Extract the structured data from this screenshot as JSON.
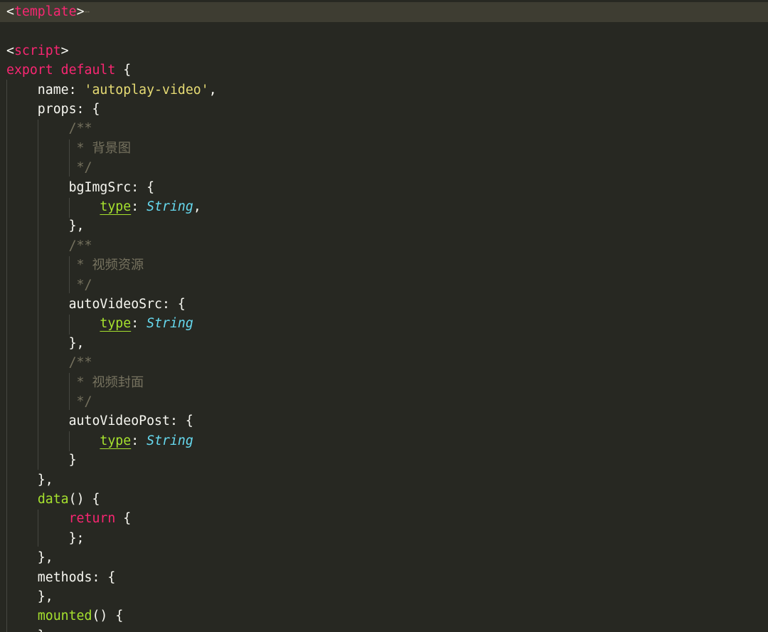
{
  "editor": {
    "fold_marker": "⋯",
    "lines": [
      [
        {
          "t": "<",
          "c": "c-punct"
        },
        {
          "t": "template",
          "c": "c-tag"
        },
        {
          "t": ">",
          "c": "c-punct"
        },
        {
          "t": "⋯",
          "c": "c-fold"
        }
      ],
      [],
      [
        {
          "t": "<",
          "c": "c-punct"
        },
        {
          "t": "script",
          "c": "c-tag"
        },
        {
          "t": ">",
          "c": "c-punct"
        }
      ],
      [
        {
          "t": "export default",
          "c": "c-keyword"
        },
        {
          "t": " {",
          "c": "c-punct"
        }
      ],
      [
        {
          "t": "    name: ",
          "c": "c-prop"
        },
        {
          "t": "'autoplay-video'",
          "c": "c-string"
        },
        {
          "t": ",",
          "c": "c-punct"
        }
      ],
      [
        {
          "t": "    props: {",
          "c": "c-prop"
        }
      ],
      [
        {
          "t": "        /**",
          "c": "c-comment"
        }
      ],
      [
        {
          "t": "         * 背景图",
          "c": "c-comment"
        }
      ],
      [
        {
          "t": "         */",
          "c": "c-comment"
        }
      ],
      [
        {
          "t": "        bgImgSrc: {",
          "c": "c-prop"
        }
      ],
      [
        {
          "t": "            ",
          "c": "c-punct"
        },
        {
          "t": "type",
          "c": "c-attr"
        },
        {
          "t": ": ",
          "c": "c-punct"
        },
        {
          "t": "String",
          "c": "c-type"
        },
        {
          "t": ",",
          "c": "c-punct"
        }
      ],
      [
        {
          "t": "        },",
          "c": "c-punct"
        }
      ],
      [
        {
          "t": "        /**",
          "c": "c-comment"
        }
      ],
      [
        {
          "t": "         * 视频资源",
          "c": "c-comment"
        }
      ],
      [
        {
          "t": "         */",
          "c": "c-comment"
        }
      ],
      [
        {
          "t": "        autoVideoSrc: {",
          "c": "c-prop"
        }
      ],
      [
        {
          "t": "            ",
          "c": "c-punct"
        },
        {
          "t": "type",
          "c": "c-attr"
        },
        {
          "t": ": ",
          "c": "c-punct"
        },
        {
          "t": "String",
          "c": "c-type"
        }
      ],
      [
        {
          "t": "        },",
          "c": "c-punct"
        }
      ],
      [
        {
          "t": "        /**",
          "c": "c-comment"
        }
      ],
      [
        {
          "t": "         * 视频封面",
          "c": "c-comment"
        }
      ],
      [
        {
          "t": "         */",
          "c": "c-comment"
        }
      ],
      [
        {
          "t": "        autoVideoPost: {",
          "c": "c-prop"
        }
      ],
      [
        {
          "t": "            ",
          "c": "c-punct"
        },
        {
          "t": "type",
          "c": "c-attr"
        },
        {
          "t": ": ",
          "c": "c-punct"
        },
        {
          "t": "String",
          "c": "c-type"
        }
      ],
      [
        {
          "t": "        }",
          "c": "c-punct"
        }
      ],
      [
        {
          "t": "    },",
          "c": "c-punct"
        }
      ],
      [
        {
          "t": "    ",
          "c": "c-punct"
        },
        {
          "t": "data",
          "c": "c-func"
        },
        {
          "t": "() {",
          "c": "c-punct"
        }
      ],
      [
        {
          "t": "        ",
          "c": "c-punct"
        },
        {
          "t": "return",
          "c": "c-keyword"
        },
        {
          "t": " {",
          "c": "c-punct"
        }
      ],
      [
        {
          "t": "        };",
          "c": "c-punct"
        }
      ],
      [
        {
          "t": "    },",
          "c": "c-punct"
        }
      ],
      [
        {
          "t": "    methods: {",
          "c": "c-prop"
        }
      ],
      [
        {
          "t": "    },",
          "c": "c-punct"
        }
      ],
      [
        {
          "t": "    ",
          "c": "c-punct"
        },
        {
          "t": "mounted",
          "c": "c-func"
        },
        {
          "t": "() {",
          "c": "c-punct"
        }
      ],
      [
        {
          "t": "    }",
          "c": "c-punct"
        }
      ]
    ]
  },
  "theme": {
    "background": "#272822",
    "highlight_line": "#3e3d32",
    "tag": "#f92672",
    "keyword": "#f92672",
    "string": "#e6db74",
    "attr": "#a6e22e",
    "type": "#66d9ef",
    "comment": "#75715e",
    "function": "#a6e22e",
    "text": "#f8f8f2"
  }
}
